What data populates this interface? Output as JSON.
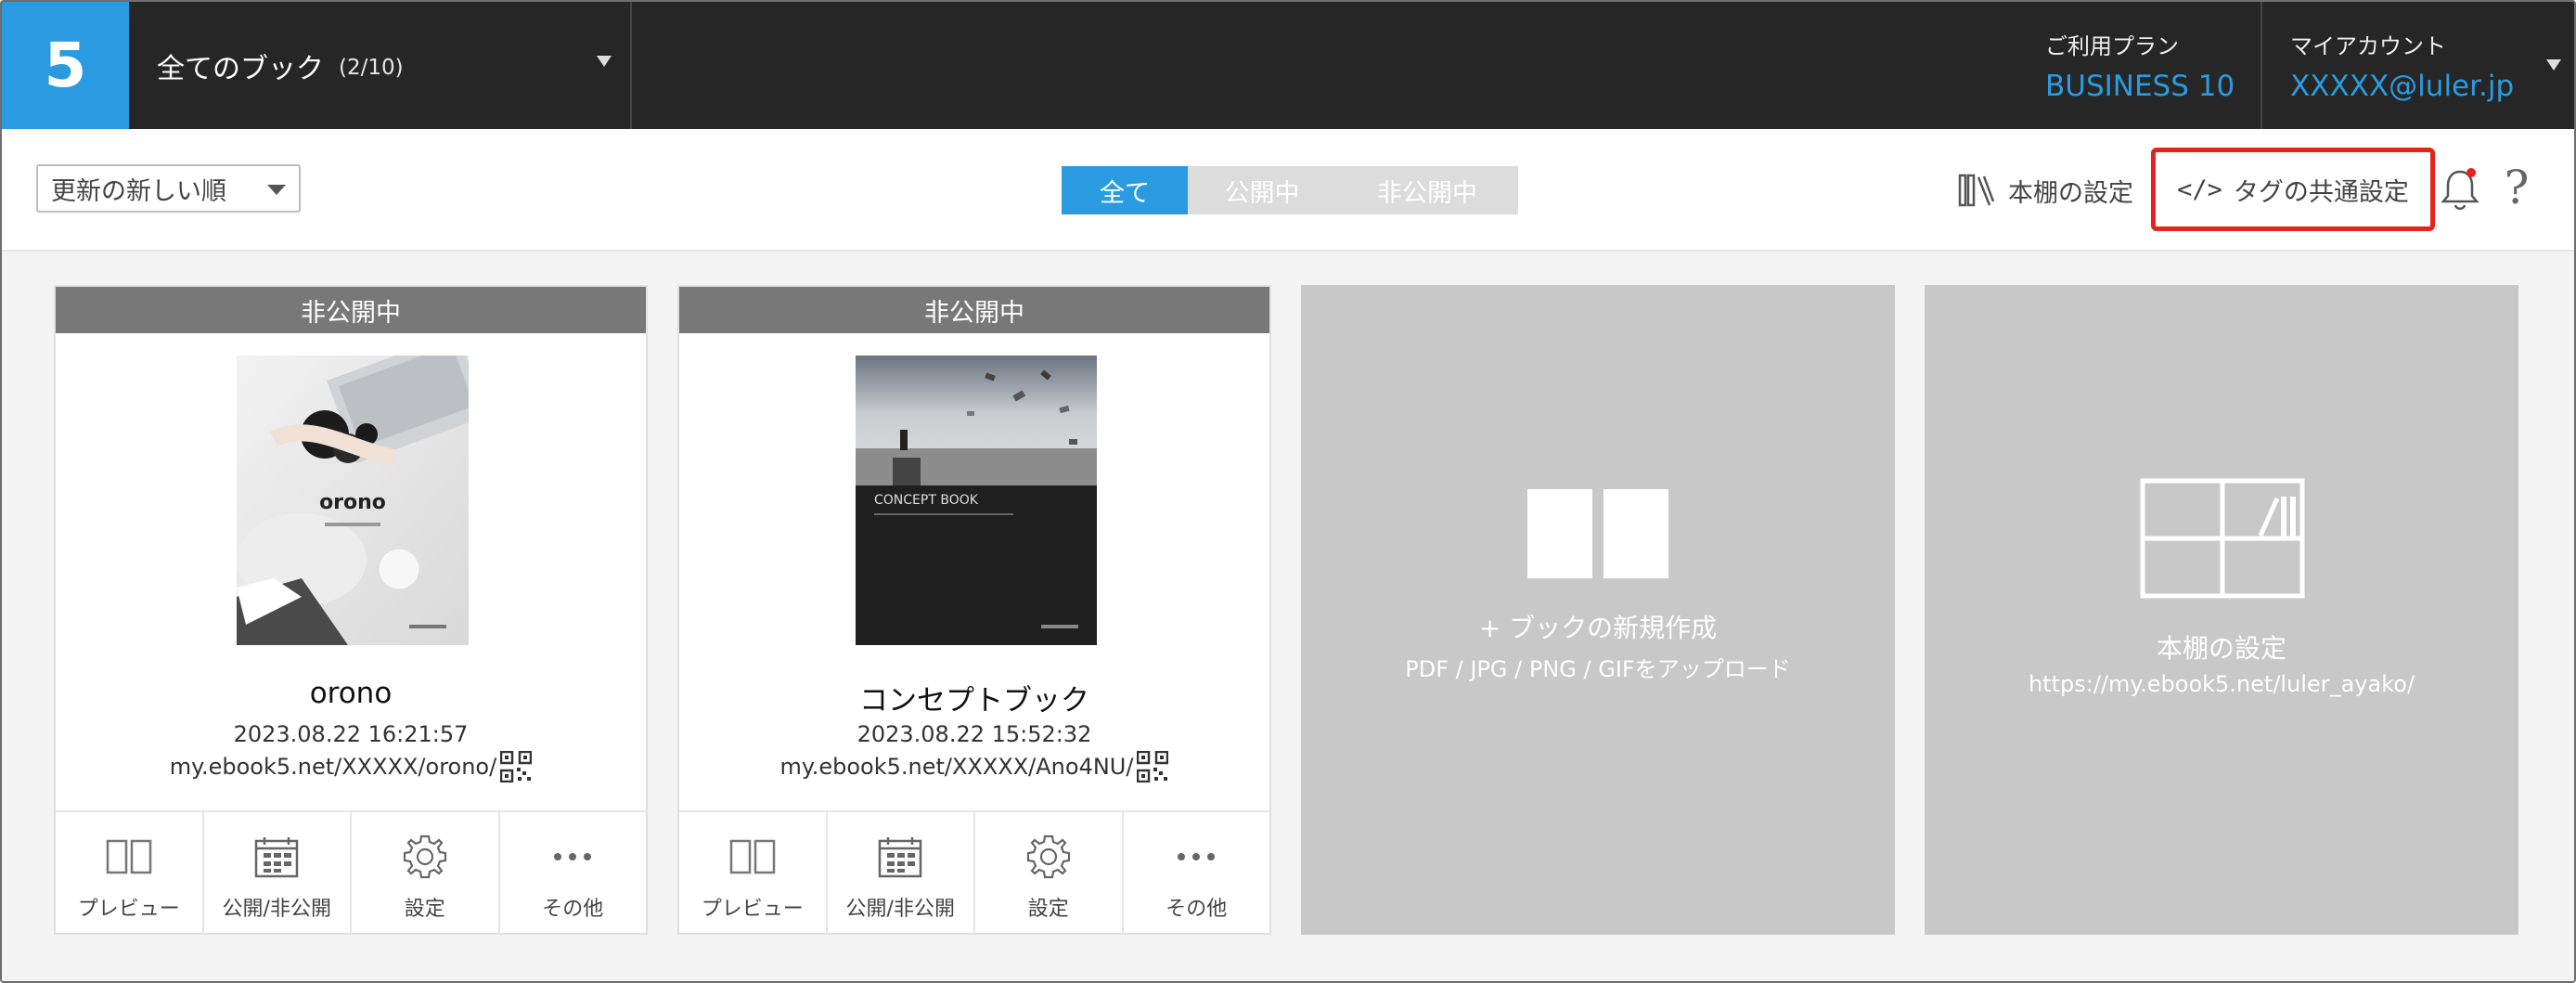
{
  "logo": "5",
  "header": {
    "book_select_title": "全てのブック",
    "book_select_count": "(2/10)",
    "plan_label": "ご利用プラン",
    "plan_value": "BUSINESS 10",
    "account_label": "マイアカウント",
    "account_value": "XXXXX@luler.jp"
  },
  "toolbar": {
    "sort_value": "更新の新しい順",
    "filters": [
      "全て",
      "公開中",
      "非公開中"
    ],
    "active_filter": 0,
    "shelf_settings": "本棚の設定",
    "tag_common_code": "</>",
    "tag_common_label": "タグの共通設定",
    "help": "?"
  },
  "books": [
    {
      "status": "非公開中",
      "title": "orono",
      "date": "2023.08.22 16:21:57",
      "url": "my.ebook5.net/XXXXX/orono/",
      "cover_title": "orono"
    },
    {
      "status": "非公開中",
      "title": "コンセプトブック",
      "date": "2023.08.22 15:52:32",
      "url": "my.ebook5.net/XXXXX/Ano4NU/",
      "cover_title": "CONCEPT BOOK"
    }
  ],
  "book_actions": {
    "preview": "プレビュー",
    "publish": "公開/非公開",
    "settings": "設定",
    "more": "その他"
  },
  "new_book": {
    "title": "+ ブックの新規作成",
    "subtitle": "PDF / JPG / PNG / GIFをアップロード"
  },
  "shelf_tile": {
    "title": "本棚の設定",
    "url": "https://my.ebook5.net/luler_ayako/"
  },
  "colors": {
    "accent": "#2a9be0",
    "header_bg": "#262626",
    "highlight_border": "#e5231b",
    "status_bg": "#787878",
    "tile_bg": "#c8c8c8"
  }
}
